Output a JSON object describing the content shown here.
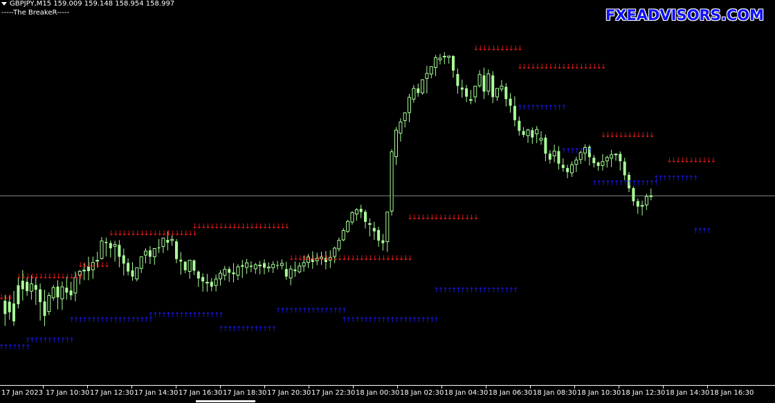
{
  "header": {
    "symbol_line": "GBPJPY,M15  159.009 159.148 158.954 158.997",
    "indicator_name": "-----The BreakeR-----"
  },
  "watermark": "FXEADVISORS.COM",
  "colors": {
    "background": "#000000",
    "candle": "#aaff99",
    "sell_arrow": "#ff1a1a",
    "buy_arrow": "#1a1aff",
    "price_line": "#8a8a8a",
    "text": "#ffffff"
  },
  "time_axis": {
    "labels": [
      "17 Jan 2023",
      "17 Jan 10:30",
      "17 Jan 12:30",
      "17 Jan 14:30",
      "17 Jan 16:30",
      "17 Jan 18:30",
      "17 Jan 20:30",
      "17 Jan 22:30",
      "18 Jan 00:30",
      "18 Jan 02:30",
      "18 Jan 04:30",
      "18 Jan 06:30",
      "18 Jan 08:30",
      "18 Jan 10:30",
      "18 Jan 12:30",
      "18 Jan 14:30",
      "18 Jan 16:30"
    ]
  },
  "chart_data": {
    "type": "candlestick",
    "symbol": "GBPJPY",
    "timeframe": "M15",
    "last_bar": {
      "open": 159.009,
      "high": 159.148,
      "low": 158.954,
      "close": 158.997
    },
    "indicator": "The BreakeR",
    "y_range_units": [
      0,
      100
    ],
    "candles": [
      [
        1,
        25.7,
        23.3,
        17.5,
        12.3
      ],
      [
        2,
        25.6,
        22.9,
        18.3,
        15.0
      ],
      [
        3,
        27.6,
        22.1,
        14.3,
        12.3
      ],
      [
        4,
        33.3,
        30.1,
        21.8,
        19.9
      ],
      [
        5,
        36.8,
        32.1,
        28.4,
        23.3
      ],
      [
        6,
        33.5,
        31.6,
        27.5,
        25.5
      ],
      [
        7,
        34.4,
        27.5,
        30.7,
        23.8
      ],
      [
        8,
        33.7,
        30.2,
        28.1,
        21.5
      ],
      [
        9,
        30.9,
        28.3,
        22.7,
        14.6
      ],
      [
        10,
        28.1,
        23.0,
        16.7,
        12.2
      ],
      [
        11,
        26.9,
        18.6,
        25.6,
        17.1
      ],
      [
        12,
        30.2,
        24.6,
        29.1,
        23.3
      ],
      [
        13,
        32.3,
        29.5,
        24.8,
        19.5
      ],
      [
        14,
        31.7,
        24.2,
        29.4,
        19.3
      ],
      [
        15,
        33.9,
        29.0,
        26.9,
        23.8
      ],
      [
        16,
        31.6,
        27.8,
        25.7,
        23.6
      ],
      [
        17,
        36.1,
        26.7,
        33.4,
        23.1
      ],
      [
        18,
        36.8,
        34.5,
        36.2,
        30.5
      ],
      [
        19,
        39.7,
        36.5,
        36.7,
        32.3
      ],
      [
        20,
        42.6,
        38.4,
        36.3,
        32.3
      ],
      [
        21,
        42.7,
        36.9,
        40.1,
        32.9
      ],
      [
        22,
        44.8,
        40.7,
        41.0,
        37.9
      ],
      [
        23,
        51.2,
        41.8,
        49.5,
        41.3
      ],
      [
        24,
        51.0,
        49.1,
        48.6,
        42.8
      ],
      [
        25,
        49.7,
        48.6,
        46.3,
        42.3
      ],
      [
        26,
        49.6,
        47.2,
        48.0,
        40.5
      ],
      [
        27,
        49.9,
        47.8,
        42.6,
        38.0
      ],
      [
        28,
        46.2,
        43.2,
        39.6,
        34.4
      ],
      [
        29,
        41.9,
        39.9,
        36.1,
        34.4
      ],
      [
        30,
        40.2,
        36.6,
        33.9,
        32.1
      ],
      [
        31,
        37.1,
        32.9,
        37.8,
        31.8
      ],
      [
        32,
        42.4,
        37.5,
        42.6,
        35.5
      ],
      [
        33,
        46.3,
        43.3,
        45.1,
        39.8
      ],
      [
        34,
        47.3,
        45.4,
        42.6,
        39.4
      ],
      [
        35,
        45.9,
        42.6,
        46.2,
        39.1
      ],
      [
        36,
        50.4,
        46.7,
        46.3,
        44.2
      ],
      [
        37,
        50.7,
        47.1,
        50.8,
        44.2
      ],
      [
        38,
        53.8,
        50.0,
        48.8,
        45.4
      ],
      [
        39,
        52.0,
        49.7,
        50.2,
        47.4
      ],
      [
        40,
        50.4,
        49.3,
        41.6,
        39.8
      ],
      [
        41,
        44.6,
        41.3,
        40.5,
        34.7
      ],
      [
        42,
        40.0,
        40.5,
        36.7,
        35.4
      ],
      [
        43,
        40.7,
        36.2,
        41.1,
        32.9
      ],
      [
        44,
        41.4,
        41.0,
        36.5,
        34.6
      ],
      [
        45,
        36.6,
        36.1,
        33.1,
        29.4
      ],
      [
        46,
        35.3,
        33.7,
        31.8,
        27.3
      ],
      [
        47,
        35.1,
        31.1,
        31.4,
        27.3
      ],
      [
        48,
        33.3,
        31.6,
        29.5,
        27.5
      ],
      [
        49,
        34.8,
        30.0,
        32.8,
        27.4
      ],
      [
        50,
        36.8,
        32.9,
        35.4,
        29.9
      ],
      [
        51,
        38.6,
        34.5,
        37.1,
        32.2
      ],
      [
        52,
        38.3,
        37.2,
        35.6,
        31.6
      ],
      [
        53,
        39.8,
        35.5,
        35.5,
        31.4
      ],
      [
        54,
        39.3,
        34.5,
        38.2,
        32.4
      ],
      [
        55,
        41.2,
        38.9,
        38.2,
        33.3
      ],
      [
        56,
        41.7,
        37.9,
        39.9,
        35.1
      ],
      [
        57,
        40.6,
        38.7,
        38.2,
        35.8
      ],
      [
        58,
        39.9,
        37.3,
        39.1,
        35.1
      ],
      [
        59,
        40.8,
        38.7,
        38.9,
        34.9
      ],
      [
        60,
        41.5,
        39.8,
        37.8,
        34.9
      ],
      [
        61,
        40.1,
        37.7,
        38.1,
        35.8
      ],
      [
        62,
        40.7,
        37.8,
        39.3,
        35.5
      ],
      [
        63,
        40.8,
        38.9,
        38.8,
        37.1
      ],
      [
        64,
        41.5,
        38.8,
        39.7,
        37.1
      ],
      [
        65,
        40.4,
        37.2,
        33.9,
        32.5
      ],
      [
        66,
        38.8,
        33.3,
        37.2,
        30.1
      ],
      [
        67,
        40.5,
        37.0,
        36.3,
        33.8
      ],
      [
        68,
        40.1,
        36.0,
        38.5,
        35.3
      ],
      [
        69,
        43.1,
        38.5,
        40.0,
        36.1
      ],
      [
        70,
        43.8,
        40.1,
        42.5,
        37.7
      ],
      [
        71,
        45.0,
        41.8,
        40.3,
        37.3
      ],
      [
        72,
        44.4,
        40.8,
        41.9,
        38.9
      ],
      [
        73,
        44.8,
        41.8,
        42.5,
        39.0
      ],
      [
        74,
        45.1,
        42.1,
        40.3,
        37.1
      ],
      [
        75,
        45.4,
        41.1,
        42.3,
        37.7
      ],
      [
        76,
        47.0,
        42.7,
        46.4,
        39.8
      ],
      [
        77,
        51.0,
        46.1,
        49.8,
        44.9
      ],
      [
        78,
        55.2,
        50.0,
        54.1,
        49.4
      ],
      [
        79,
        58.8,
        53.7,
        58.1,
        53.1
      ],
      [
        80,
        62.6,
        57.8,
        61.9,
        56.7
      ],
      [
        81,
        63.9,
        61.3,
        63.2,
        58.4
      ],
      [
        82,
        65.4,
        63.6,
        62.2,
        59.5
      ],
      [
        83,
        63.2,
        62.3,
        57.9,
        55.0
      ],
      [
        84,
        59.4,
        56.8,
        57.1,
        51.5
      ],
      [
        85,
        57.9,
        55.2,
        53.7,
        50.0
      ],
      [
        86,
        55.7,
        54.3,
        49.7,
        47.0
      ],
      [
        87,
        52.6,
        49.8,
        48.6,
        45.3
      ],
      [
        88,
        53.4,
        49.2,
        62.2,
        44.8
      ],
      [
        89,
        89.8,
        62.6,
        88.6,
        60.7
      ],
      [
        90,
        99.5,
        86.5,
        98.1,
        82.8
      ],
      [
        91,
        103.3,
        96.8,
        101.7,
        93.1
      ],
      [
        92,
        106.0,
        102.3,
        105.7,
        99.3
      ],
      [
        93,
        114.0,
        105.8,
        112.5,
        101.6
      ],
      [
        94,
        117.9,
        111.7,
        116.4,
        110.1
      ],
      [
        95,
        118.5,
        116.4,
        114.4,
        112.7
      ],
      [
        96,
        119.3,
        114.4,
        120.2,
        113.6
      ],
      [
        97,
        126.3,
        120.8,
        123.0,
        114.2
      ],
      [
        98,
        126.1,
        122.7,
        125.9,
        120.8
      ],
      [
        99,
        131.1,
        125.6,
        129.9,
        121.8
      ],
      [
        100,
        131.5,
        128.9,
        129.7,
        126.9
      ],
      [
        101,
        132.3,
        130.4,
        130.5,
        127.0
      ],
      [
        102,
        130.6,
        130.0,
        130.6,
        127.2
      ],
      [
        103,
        131.0,
        130.6,
        124.2,
        121.1
      ],
      [
        104,
        125.1,
        122.7,
        117.5,
        114.1
      ],
      [
        105,
        120.2,
        116.8,
        115.9,
        112.3
      ],
      [
        106,
        117.9,
        116.4,
        112.8,
        110.5
      ],
      [
        107,
        115.7,
        111.3,
        111.5,
        109.5
      ],
      [
        108,
        114.5,
        112.7,
        117.4,
        110.2
      ],
      [
        109,
        124.4,
        117.6,
        122.5,
        116.8
      ],
      [
        110,
        125.5,
        122.1,
        115.0,
        111.7
      ],
      [
        111,
        124.7,
        115.2,
        122.8,
        113.4
      ],
      [
        112,
        124.0,
        122.1,
        112.6,
        109.9
      ],
      [
        113,
        116.3,
        112.7,
        116.4,
        110.9
      ],
      [
        114,
        120.1,
        116.1,
        117.4,
        114.9
      ],
      [
        115,
        118.7,
        117.1,
        111.7,
        108.5
      ],
      [
        116,
        114.4,
        111.9,
        108.8,
        105.8
      ],
      [
        117,
        112.9,
        108.7,
        102.5,
        99.8
      ],
      [
        118,
        104.1,
        102.2,
        97.8,
        95.7
      ],
      [
        119,
        99.4,
        97.7,
        96.0,
        94.9
      ],
      [
        120,
        98.7,
        95.7,
        98.2,
        92.5
      ],
      [
        121,
        99.3,
        98.1,
        94.9,
        92.1
      ],
      [
        122,
        99.9,
        96.5,
        98.4,
        92.4
      ],
      [
        123,
        97.6,
        93.7,
        94.5,
        91.7
      ],
      [
        124,
        96.2,
        94.8,
        87.8,
        84.5
      ],
      [
        125,
        89.3,
        87.8,
        85.2,
        83.4
      ],
      [
        126,
        91.8,
        86.8,
        88.9,
        84.0
      ],
      [
        127,
        91.0,
        88.9,
        83.4,
        80.8
      ],
      [
        128,
        85.8,
        82.9,
        81.5,
        79.9
      ],
      [
        129,
        82.9,
        81.5,
        79.7,
        77.0
      ],
      [
        130,
        84.4,
        79.4,
        82.9,
        77.6
      ],
      [
        131,
        86.4,
        83.1,
        85.0,
        79.7
      ],
      [
        132,
        89.1,
        85.2,
        88.2,
        83.3
      ],
      [
        133,
        91.9,
        88.1,
        90.5,
        84.6
      ],
      [
        134,
        91.7,
        90.8,
        86.3,
        82.6
      ],
      [
        135,
        87.2,
        86.0,
        83.6,
        81.7
      ],
      [
        136,
        84.3,
        83.9,
        82.4,
        80.3
      ],
      [
        137,
        87.6,
        82.6,
        84.3,
        80.4
      ],
      [
        138,
        86.9,
        84.6,
        86.1,
        81.7
      ],
      [
        139,
        89.5,
        85.8,
        87.3,
        81.9
      ],
      [
        140,
        87.9,
        87.4,
        87.6,
        84.7
      ],
      [
        141,
        88.8,
        87.7,
        84.5,
        80.4
      ],
      [
        142,
        86.0,
        84.3,
        78.3,
        76.2
      ],
      [
        143,
        79.8,
        78.5,
        72.6,
        70.9
      ],
      [
        144,
        73.4,
        72.7,
        66.9,
        65.0
      ],
      [
        145,
        68.1,
        67.0,
        64.6,
        61.4
      ],
      [
        146,
        67.2,
        64.8,
        65.1,
        60.7
      ],
      [
        147,
        70.2,
        65.3,
        69.0,
        63.1
      ],
      [
        148,
        72.5,
        69.1,
        69.3,
        67.4
      ]
    ]
  }
}
